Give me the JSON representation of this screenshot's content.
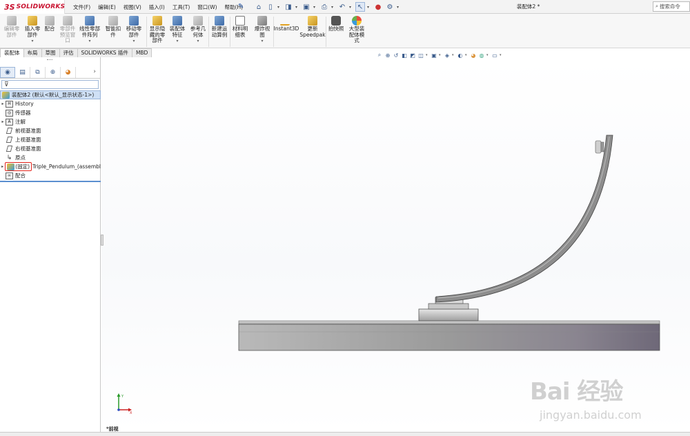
{
  "app": {
    "logo_text": "SOLIDWORKS",
    "logo_prefix": "3S",
    "document_title": "装配体2 *",
    "search_placeholder": "搜索命令"
  },
  "menu": [
    "文件(F)",
    "编辑(E)",
    "视图(V)",
    "插入(I)",
    "工具(T)",
    "窗口(W)",
    "帮助(H)"
  ],
  "ribbon": {
    "buttons": [
      {
        "label": "编辑零\n部件",
        "enabled": false
      },
      {
        "label": "插入零\n部件",
        "enabled": true
      },
      {
        "label": "配合",
        "enabled": true
      },
      {
        "label": "零部件\n预览窗\n口",
        "enabled": false
      },
      {
        "label": "线性零部\n件阵列",
        "enabled": true
      },
      {
        "label": "智能扣\n件",
        "enabled": true
      },
      {
        "label": "移动零\n部件",
        "enabled": true
      },
      {
        "label": "显示隐\n藏的零\n部件",
        "enabled": true
      },
      {
        "label": "装配体\n特征",
        "enabled": true
      },
      {
        "label": "参考几\n何体",
        "enabled": true
      },
      {
        "label": "新建运\n动算例",
        "enabled": true
      },
      {
        "label": "材料明\n细表",
        "enabled": true
      },
      {
        "label": "爆炸视\n图",
        "enabled": true
      },
      {
        "label": "Instant3D",
        "enabled": true
      },
      {
        "label": "更新\nSpeedpak",
        "enabled": true
      },
      {
        "label": "拍快照",
        "enabled": true
      },
      {
        "label": "大型装\n配体模\n式",
        "enabled": true
      }
    ]
  },
  "tabs": [
    "装配体",
    "布局",
    "草图",
    "评估",
    "SOLIDWORKS 插件",
    "MBD"
  ],
  "active_tab": "装配体",
  "feature_tree": {
    "root": "装配体2 (默认<默认_显示状态-1>)",
    "items": [
      {
        "label": "History",
        "icon": "history-icon",
        "expandable": true
      },
      {
        "label": "传感器",
        "icon": "sensor-icon",
        "expandable": false
      },
      {
        "label": "注解",
        "icon": "annotation-icon",
        "expandable": true
      },
      {
        "label": "前视基准面",
        "icon": "plane-icon",
        "expandable": false
      },
      {
        "label": "上视基准面",
        "icon": "plane-icon",
        "expandable": false
      },
      {
        "label": "右视基准面",
        "icon": "plane-icon",
        "expandable": false
      },
      {
        "label": "原点",
        "icon": "origin-icon",
        "expandable": false
      }
    ],
    "component": {
      "state": "(固定)",
      "name": "Triple_Pendulum_(assembl"
    },
    "mates": "配合"
  },
  "view": {
    "name": "*前视"
  },
  "watermark": {
    "main": "Bai 经验",
    "sub": "jingyan.baidu.com"
  },
  "colors": {
    "accent": "#c8102e",
    "selection": "#cfe0f5",
    "highlight_box": "#e2231a"
  }
}
